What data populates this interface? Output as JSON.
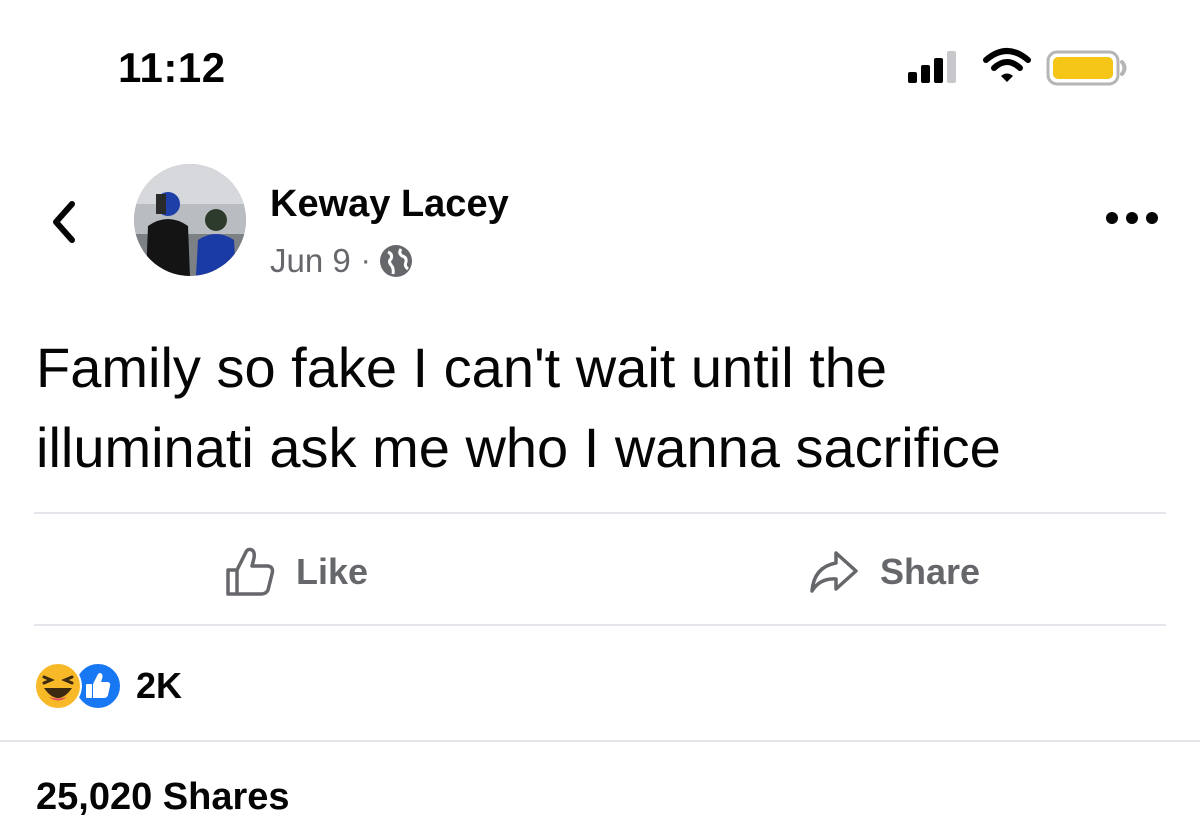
{
  "status_bar": {
    "time": "11:12",
    "icons": [
      "cellular-signal-icon",
      "wifi-icon",
      "battery-icon"
    ],
    "battery_color": "#f5c518"
  },
  "post": {
    "author": "Keway Lacey",
    "date": "Jun 9",
    "separator": "·",
    "audience_icon": "globe-icon",
    "text": "Family so fake I can't wait until the\nilluminati ask me who I wanna sacrifice"
  },
  "actions": {
    "like_label": "Like",
    "share_label": "Share"
  },
  "reactions": {
    "icons": [
      "haha-reaction-icon",
      "like-reaction-icon"
    ],
    "count": "2K"
  },
  "shares_text": "25,020 Shares",
  "colors": {
    "text_primary": "#050505",
    "text_secondary": "#65676b",
    "divider": "#e4e6eb",
    "like_blue": "#1877f2",
    "haha_yellow": "#f7b928"
  }
}
